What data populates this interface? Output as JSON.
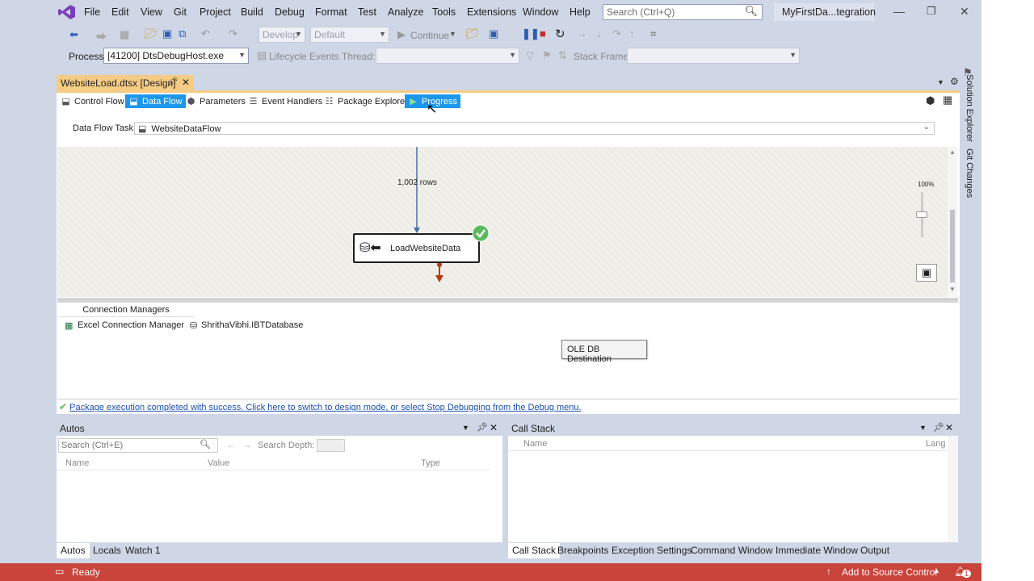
{
  "menu": [
    "File",
    "Edit",
    "View",
    "Git",
    "Project",
    "Build",
    "Debug",
    "Format",
    "Test",
    "Analyze",
    "Tools",
    "Extensions",
    "Window",
    "Help"
  ],
  "search": {
    "placeholder": "Search (Ctrl+Q)"
  },
  "project_name": "MyFirstDa...tegration",
  "toolbar": {
    "config_combo": "Develop",
    "platform_combo": "Default",
    "continue_label": "Continue",
    "process_label": "Process:",
    "process_value": "[41200] DtsDebugHost.exe",
    "lifecycle_label": "Lifecycle Events",
    "thread_label": "Thread:",
    "stack_frame_label": "Stack Frame:"
  },
  "side_tabs": [
    "Solution Explorer",
    "Git Changes"
  ],
  "doc_tab": {
    "title": "WebsiteLoad.dtsx [Design]"
  },
  "design_tabs": [
    {
      "label": "Control Flow",
      "icon": "control-flow-icon"
    },
    {
      "label": "Data Flow",
      "icon": "data-flow-icon"
    },
    {
      "label": "Parameters",
      "icon": "parameters-icon"
    },
    {
      "label": "Event Handlers",
      "icon": "event-handlers-icon"
    },
    {
      "label": "Package Explorer",
      "icon": "package-explorer-icon"
    },
    {
      "label": "Progress",
      "icon": "progress-icon"
    }
  ],
  "data_flow_task": {
    "label": "Data Flow Task:",
    "value": "WebsiteDataFlow"
  },
  "canvas": {
    "row_count": "1,002 rows",
    "node_label": "LoadWebsiteData",
    "zoom": "100%",
    "zoom_level": 0.5
  },
  "connection_managers": {
    "tab_label": "Connection Managers",
    "items": [
      "Excel Connection Manager",
      "ShrithaVibhi.IBTDatabase"
    ]
  },
  "tooltip": "OLE DB Destination",
  "status_message": "Package execution completed with success. Click here to switch to design mode, or select Stop Debugging from the Debug menu.",
  "autos": {
    "title": "Autos",
    "search_placeholder": "Search (Ctrl+E)",
    "search_depth_label": "Search Depth:",
    "columns": [
      "Name",
      "Value",
      "Type"
    ],
    "tabs": [
      "Autos",
      "Locals",
      "Watch 1"
    ]
  },
  "callstack": {
    "title": "Call Stack",
    "columns": [
      "Name",
      "Lang"
    ],
    "tabs": [
      "Call Stack",
      "Breakpoints",
      "Exception Settings",
      "Command Window",
      "Immediate Window",
      "Output"
    ]
  },
  "statusbar": {
    "status": "Ready",
    "source_control": "Add to Source Control",
    "notifications": "1"
  },
  "colors": {
    "accent": "#1c97ea",
    "doc_tab": "#f5cc84",
    "statusbar": "#c9443b",
    "success": "#5cb85c"
  }
}
